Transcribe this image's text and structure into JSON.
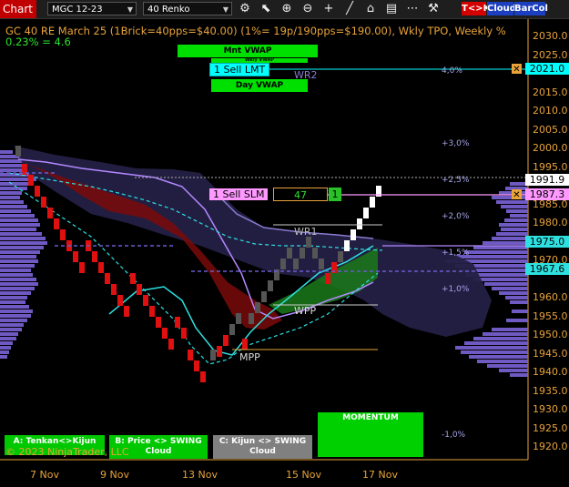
{
  "toolbar": {
    "tab_label": "Chart",
    "instrument": "MGC 12-23",
    "bar_type": "40 Renko",
    "icons": [
      "tools-icon",
      "select-icon",
      "zoom-in-icon",
      "zoom-out-icon",
      "crosshair-icon",
      "draw-line-icon",
      "indicators-icon",
      "strategies-icon",
      "template-icon",
      "properties-icon"
    ],
    "tk_button": "T<>K",
    "cloud_button": "Cloud",
    "barcol_button": "BarCol"
  },
  "chart": {
    "title": "GC 40 RE March 25 (1Brick=40pps=$40.00)  (1%= 19p/190pps=$190.00), Wkly TPO, Weekly %",
    "subtitle": "0.23% = 4.6",
    "copyright": "© 2023 NinjaTrader, LLC",
    "y_ticks": [
      "2030.0",
      "2025.0",
      "2020.0",
      "2015.0",
      "2010.0",
      "2005.0",
      "2000.0",
      "1995.0",
      "1990.0",
      "1985.0",
      "1980.0",
      "1975.0",
      "1970.0",
      "1965.0",
      "1960.0",
      "1955.0",
      "1950.0",
      "1945.0",
      "1940.0",
      "1935.0",
      "1930.0",
      "1925.0",
      "1920.0"
    ],
    "x_ticks": [
      "7 Nov",
      "9 Nov",
      "13 Nov",
      "15 Nov",
      "17 Nov"
    ],
    "pct_labels": [
      "4,0%",
      "+3,0%",
      "+2,5%",
      "+2,0%",
      "+1,5%",
      "+1,0%",
      "-1,0%"
    ],
    "levels": {
      "wr2": "WR2",
      "wr1": "WR1",
      "wpp": "WPP",
      "mpp": "MPP"
    },
    "vwap": {
      "mnt": "Mnt VWAP",
      "wkly": "Wkly VWAP",
      "day": "Day VWAP"
    },
    "orders": {
      "sell_lmt": "1 Sell LMT",
      "sell_slm": "1 Sell SLM",
      "position_qty": "47",
      "position_side": "1"
    },
    "price_boxes": {
      "p2021": "2021.0",
      "p1991": "1991.9",
      "p1987": "1987.3",
      "p1975": "1975.0",
      "p1967": "1967.6"
    },
    "panels": {
      "a": "A: Tenkan<>Kijun",
      "b": "B: Price <> SWING Cloud",
      "c": "C: Kijun <> SWING Cloud",
      "momentum": "MOMENTUM"
    },
    "colors": {
      "accent": "#e8a33a",
      "green_panel": "#00c800",
      "gray_panel": "#808080",
      "order_line": "#00ffff",
      "stop_line": "#ff99ff"
    }
  }
}
